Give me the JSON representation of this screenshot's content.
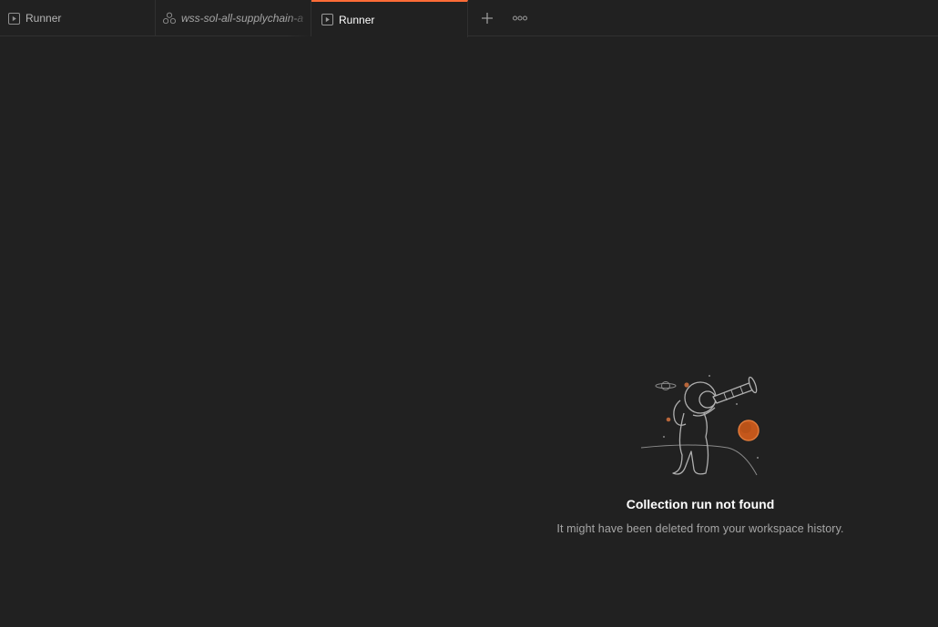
{
  "tabs": [
    {
      "label": "Runner",
      "icon": "runner-icon",
      "active": false
    },
    {
      "label": "wss-sol-all-supplychain-a",
      "icon": "collection-icon",
      "active": false
    },
    {
      "label": "Runner",
      "icon": "runner-icon",
      "active": true
    }
  ],
  "tab_actions": {
    "add_icon": "plus-icon",
    "more_icon": "more-options-icon"
  },
  "empty_state": {
    "illustration": "astronaut-telescope",
    "title": "Collection run not found",
    "subtitle": "It might have been deleted from your workspace history."
  },
  "colors": {
    "background": "#212121",
    "accent": "#ff6c37",
    "planet": "#c4571b",
    "text_primary": "#ffffff",
    "text_secondary": "#a6a6a6"
  }
}
